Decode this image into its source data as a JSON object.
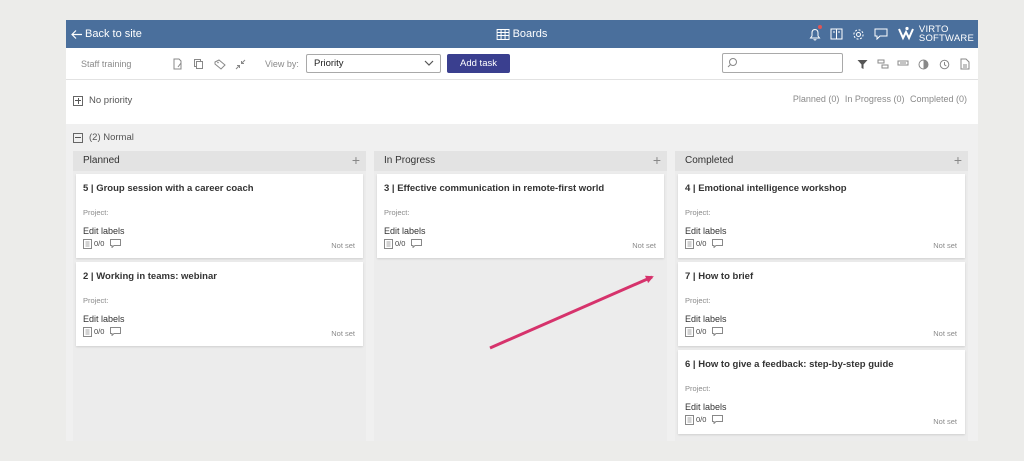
{
  "header": {
    "back_label": "Back to site",
    "title": "Boards",
    "brand_line1": "VIRTO",
    "brand_line2": "SOFTWARE",
    "icons": [
      "bell-icon",
      "book-icon",
      "gear-icon",
      "chat-icon"
    ],
    "accent_color": "#4a6f9c"
  },
  "toolbar": {
    "site_name": "Staff training",
    "view_by_label": "View by:",
    "view_by_value": "Priority",
    "add_task_label": "Add task",
    "search_placeholder": "",
    "left_icons": [
      "edit-icon",
      "copy-icon",
      "tag-icon",
      "collapse-icon"
    ],
    "right_icons": [
      "filter-icon",
      "swimlane-icon",
      "highlight-icon",
      "color-icon",
      "history-icon",
      "export-icon"
    ]
  },
  "groups": {
    "no_priority": {
      "label": "No priority",
      "summary_planned": "Planned (0)",
      "summary_in_progress": "In Progress (0)",
      "summary_completed": "Completed (0)"
    },
    "normal": {
      "label": "(2) Normal",
      "columns": [
        {
          "name": "Planned",
          "cards": [
            {
              "title": "5 | Group session with a career coach",
              "project": "Project:",
              "labels": "Edit labels",
              "checklist": "0/0",
              "due": "Not set"
            },
            {
              "title": "2 | Working in teams: webinar",
              "project": "Project:",
              "labels": "Edit labels",
              "checklist": "0/0",
              "due": "Not set"
            }
          ]
        },
        {
          "name": "In Progress",
          "cards": [
            {
              "title": "3 | Effective communication in remote-first world",
              "project": "Project:",
              "labels": "Edit labels",
              "checklist": "0/0",
              "due": "Not set"
            }
          ]
        },
        {
          "name": "Completed",
          "cards": [
            {
              "title": "4 | Emotional intelligence workshop",
              "project": "Project:",
              "labels": "Edit labels",
              "checklist": "0/0",
              "due": "Not set"
            },
            {
              "title": "7 | How to brief",
              "project": "Project:",
              "labels": "Edit labels",
              "checklist": "0/0",
              "due": "Not set"
            },
            {
              "title": "6 | How to give a feedback: step-by-step guide",
              "project": "Project:",
              "labels": "Edit labels",
              "checklist": "0/0",
              "due": "Not set"
            }
          ]
        }
      ]
    }
  },
  "annotation": {
    "arrow_color": "#d6336c"
  }
}
